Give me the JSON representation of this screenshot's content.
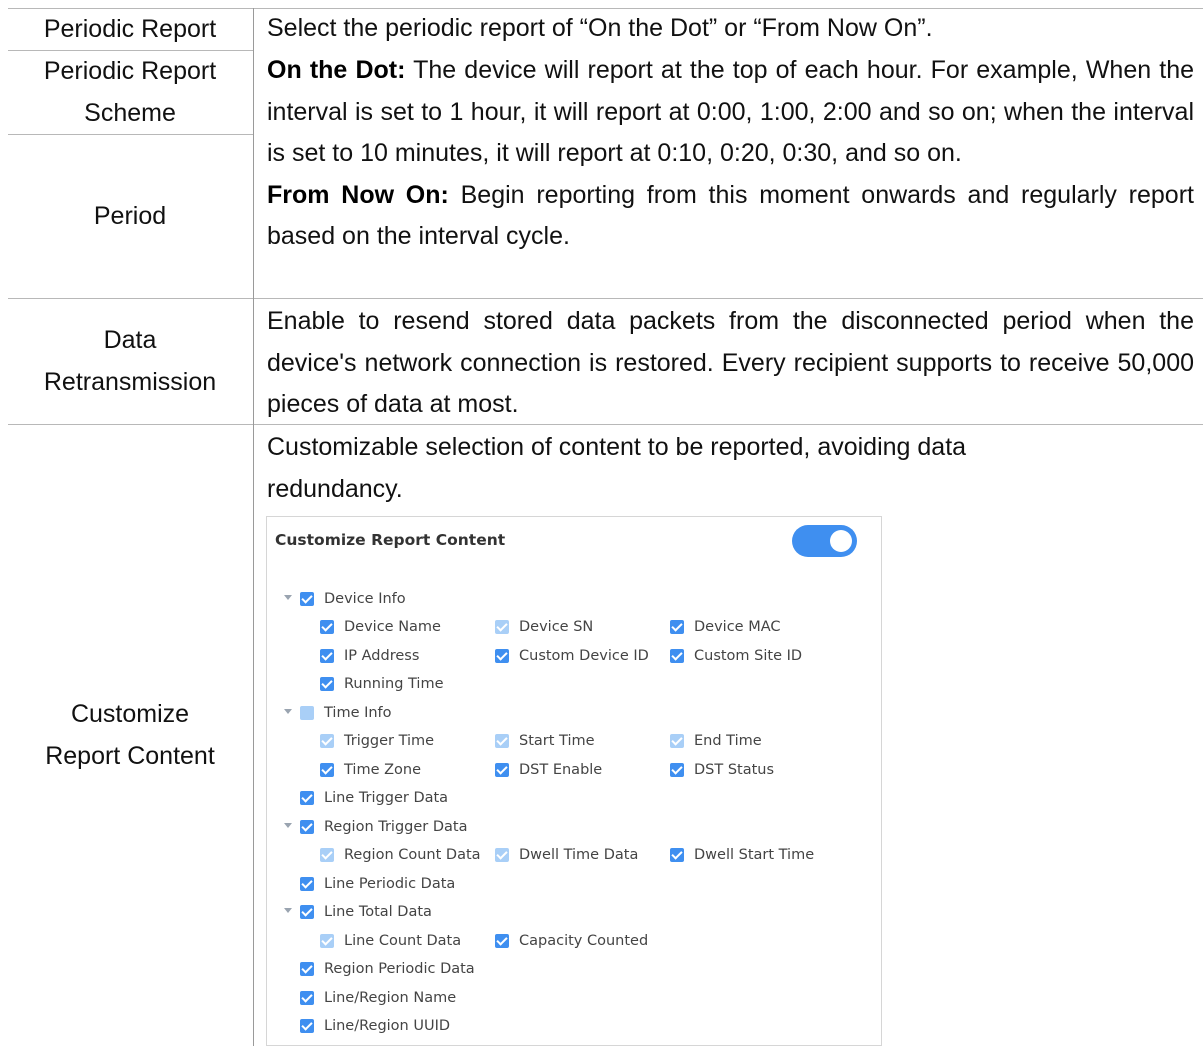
{
  "rows": [
    {
      "label": "Periodic Report",
      "text": "Select the periodic report of “On the Dot” or “From Now On”."
    },
    {
      "label_line1": "Periodic Report",
      "label_line2": "Scheme"
    },
    {
      "label": "Period",
      "on_the_dot_kw": "On the Dot:",
      "on_the_dot_text": " The device will report at the top of each hour. For example, When the interval is set to 1 hour, it will report at 0:00, 1:00, 2:00 and so on; when the interval is set to 10 minutes, it will report at 0:10, 0:20, 0:30, and so on.",
      "from_now_on_kw": "From Now On:",
      "from_now_on_text": " Begin reporting from this moment onwards and regularly report based on the interval cycle."
    },
    {
      "label_line1": "Data",
      "label_line2": "Retransmission",
      "text": "Enable to resend stored data packets from the disconnected period when the device's network connection is restored. Every recipient supports to receive 50,000 pieces of data at most."
    },
    {
      "label_line1": "Customize",
      "label_line2": "Report Content",
      "text": "Customizable selection of content to be reported, avoiding data redundancy."
    }
  ],
  "panel": {
    "title": "Customize Report Content",
    "toggle_on": true,
    "accent": "#3f8ff0",
    "items": {
      "device_info": "Device Info",
      "device_name": "Device Name",
      "device_sn": "Device SN",
      "device_mac": "Device MAC",
      "ip_address": "IP Address",
      "custom_device_id": "Custom Device ID",
      "custom_site_id": "Custom Site ID",
      "running_time": "Running Time",
      "time_info": "Time Info",
      "trigger_time": "Trigger Time",
      "start_time": "Start Time",
      "end_time": "End Time",
      "time_zone": "Time Zone",
      "dst_enable": "DST Enable",
      "dst_status": "DST Status",
      "line_trigger_data": "Line Trigger Data",
      "region_trigger_data": "Region Trigger Data",
      "region_count_data": "Region Count Data",
      "dwell_time_data": "Dwell Time Data",
      "dwell_start_time": "Dwell Start Time",
      "line_periodic_data": "Line Periodic Data",
      "line_total_data": "Line Total Data",
      "line_count_data": "Line Count Data",
      "capacity_counted": "Capacity Counted",
      "region_periodic_data": "Region Periodic Data",
      "line_region_name": "Line/Region Name",
      "line_region_uuid": "Line/Region UUID"
    }
  }
}
